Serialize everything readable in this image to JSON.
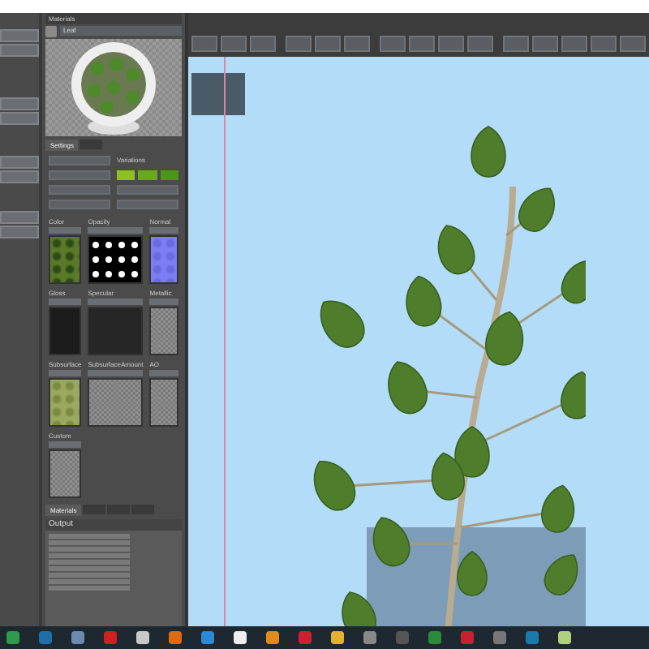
{
  "materials_panel": {
    "title": "Materials",
    "material_name": "Leaf"
  },
  "settings_tab": {
    "label": "Settings",
    "selected": true
  },
  "variations": {
    "label": "Variations",
    "swatches": [
      {
        "color": "#8cc21a"
      },
      {
        "color": "#6aaa14"
      },
      {
        "color": "#4a9a10"
      }
    ]
  },
  "slots": [
    {
      "label": "Color",
      "kind": "leaves"
    },
    {
      "label": "Opacity",
      "kind": "mask"
    },
    {
      "label": "Normal",
      "kind": "normal"
    },
    {
      "label": "Gloss",
      "kind": "dark"
    },
    {
      "label": "Specular",
      "kind": "darker"
    },
    {
      "label": "Metallic",
      "kind": "checker"
    },
    {
      "label": "Subsurface",
      "kind": "moss"
    },
    {
      "label": "SubsurfaceAmount",
      "kind": "checker"
    },
    {
      "label": "AO",
      "kind": "checker"
    },
    {
      "label": "Custom",
      "kind": "checker"
    }
  ],
  "bottom_tab": {
    "label": "Materials",
    "selected": true
  },
  "output": {
    "title": "Output"
  }
}
